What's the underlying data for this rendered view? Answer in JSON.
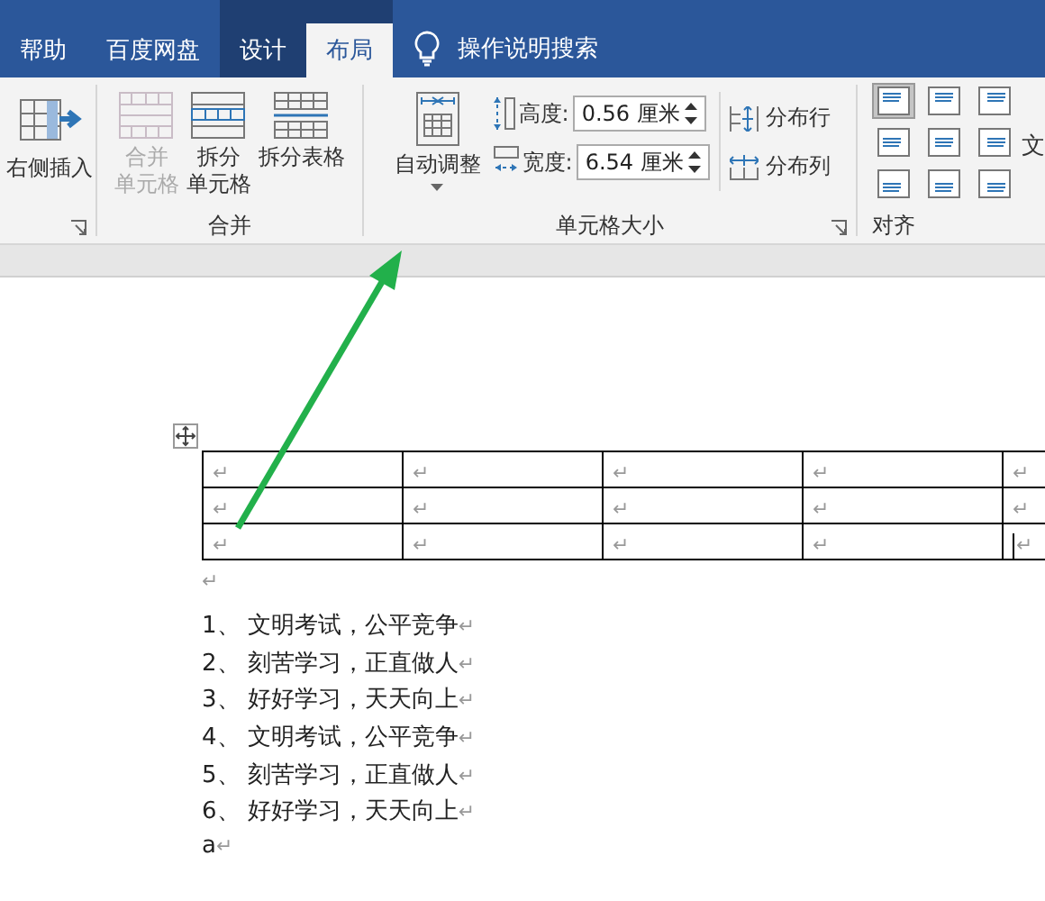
{
  "tabs": [
    {
      "label": "帮助",
      "selected": false,
      "contextual": false
    },
    {
      "label": "百度网盘",
      "selected": false,
      "contextual": false
    },
    {
      "label": "设计",
      "selected": false,
      "contextual": true
    },
    {
      "label": "布局",
      "selected": true,
      "contextual": true
    }
  ],
  "search": {
    "label": "操作说明搜索"
  },
  "ribbon": {
    "insert_group": {
      "button": "右侧插入"
    },
    "merge_group": {
      "label": "合并",
      "buttons": [
        {
          "kind": "merge",
          "lines": [
            "合并",
            "单元格"
          ],
          "disabled": true
        },
        {
          "kind": "split-cells",
          "lines": [
            "拆分",
            "单元格"
          ],
          "disabled": false
        },
        {
          "kind": "split-table",
          "lines": [
            "拆分表格"
          ],
          "disabled": false
        }
      ]
    },
    "size_group": {
      "label": "单元格大小",
      "autofit": {
        "label": "自动调整"
      },
      "fields": [
        {
          "kind": "height",
          "label": "高度:",
          "value": "0.56 厘米"
        },
        {
          "kind": "width",
          "label": "宽度:",
          "value": "6.54 厘米"
        }
      ],
      "distribute": [
        {
          "kind": "rows",
          "label": "分布行"
        },
        {
          "kind": "columns",
          "label": "分布列"
        }
      ]
    },
    "align_group": {
      "label": "对齐",
      "cells": [
        {
          "selected": true
        },
        {
          "selected": false
        },
        {
          "selected": false
        },
        {
          "selected": false
        },
        {
          "selected": false
        },
        {
          "selected": false
        },
        {
          "selected": false
        },
        {
          "selected": false
        },
        {
          "selected": false
        }
      ],
      "text_direction": "文"
    }
  },
  "table": {
    "rows": [
      [
        {
          "text": "↵",
          "cursor": false
        },
        {
          "text": "↵",
          "cursor": false
        },
        {
          "text": "↵",
          "cursor": false
        },
        {
          "text": "↵",
          "cursor": false
        },
        {
          "text": "↵",
          "cursor": false
        }
      ],
      [
        {
          "text": "↵",
          "cursor": false
        },
        {
          "text": "↵",
          "cursor": false
        },
        {
          "text": "↵",
          "cursor": false
        },
        {
          "text": "↵",
          "cursor": false
        },
        {
          "text": "↵",
          "cursor": false
        }
      ],
      [
        {
          "text": "↵",
          "cursor": false
        },
        {
          "text": "↵",
          "cursor": false
        },
        {
          "text": "↵",
          "cursor": false
        },
        {
          "text": "↵",
          "cursor": false
        },
        {
          "text": "↵",
          "cursor": true
        }
      ]
    ]
  },
  "after_table_mark": "↵",
  "list": [
    {
      "text": "1、 文明考试，公平竞争",
      "mark": "↵"
    },
    {
      "text": "2、 刻苦学习，正直做人",
      "mark": "↵"
    },
    {
      "text": "3、 好好学习，天天向上",
      "mark": "↵"
    },
    {
      "text": "4、 文明考试，公平竞争",
      "mark": "↵"
    },
    {
      "text": "5、 刻苦学习，正直做人",
      "mark": "↵"
    },
    {
      "text": "6、 好好学习，天天向上",
      "mark": "↵"
    },
    {
      "text": "a",
      "mark": "↵"
    }
  ]
}
